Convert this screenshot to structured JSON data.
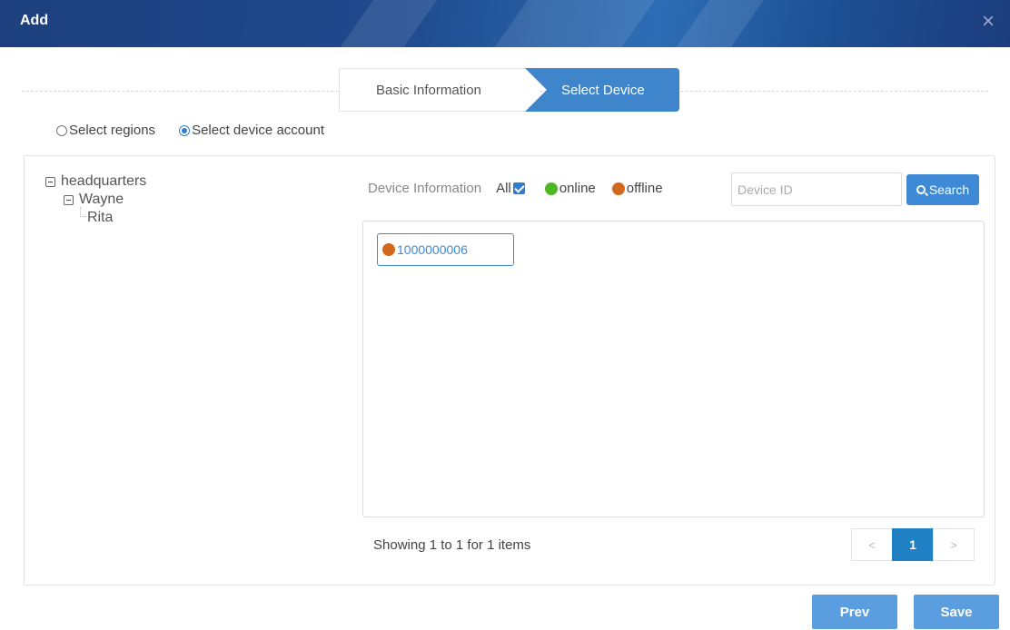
{
  "dialog": {
    "title": "Add",
    "close_glyph": "×"
  },
  "steps": [
    {
      "label": "Basic Information",
      "active": false
    },
    {
      "label": "Select Device",
      "active": true
    }
  ],
  "mode": {
    "options": [
      "Select regions",
      "Select device account"
    ],
    "selected": "Select device account"
  },
  "tree": {
    "root": "headquarters",
    "child": "Wayne",
    "leaf": "Rita"
  },
  "filter": {
    "label": "Device Information",
    "all_label": "All",
    "all_checked": true,
    "online_label": "online",
    "offline_label": "offline"
  },
  "search": {
    "placeholder": "Device ID",
    "value": "",
    "button_label": "Search"
  },
  "devices": [
    {
      "id": "1000000006",
      "status": "offline"
    }
  ],
  "pagination": {
    "summary": "Showing 1 to 1 for 1 items",
    "prev_glyph": "<",
    "current_page": "1",
    "next_glyph": ">"
  },
  "footer": {
    "prev_label": "Prev",
    "save_label": "Save"
  },
  "colors": {
    "accent": "#3f8ad6",
    "online": "#4cb824",
    "offline": "#d2681c",
    "titlebar": "#1f4a8e"
  }
}
